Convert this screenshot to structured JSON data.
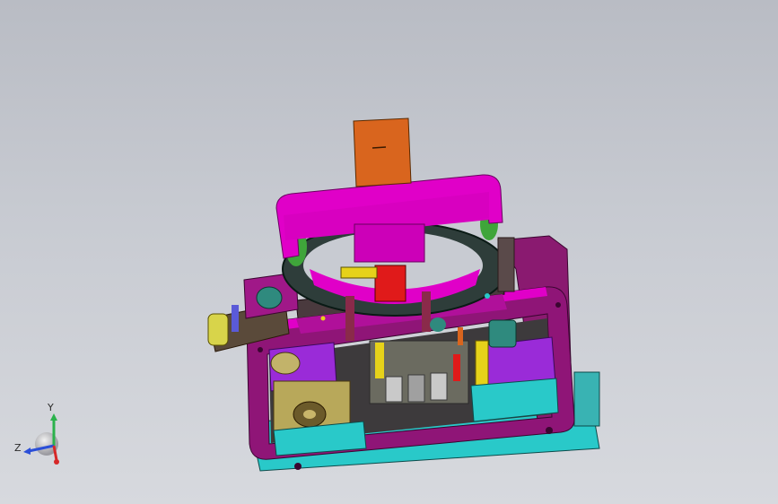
{
  "viewport": {
    "background_top": "#b9bcc4",
    "background_bottom": "#d7d9de"
  },
  "triad": {
    "y_label": "Y",
    "z_label": "Z",
    "y_color": "#2bb24c",
    "z_color": "#2b4fd8",
    "x_color": "#d62828"
  },
  "model_colors": {
    "magenta": "#e000c8",
    "dark_magenta": "#7a0a5a",
    "purple": "#9a2bd8",
    "cyan": "#29c9c9",
    "orange": "#d9651e",
    "red": "#e01a1a",
    "yellow": "#e6d21a",
    "olive": "#b8a85a",
    "teal": "#2f8a7e",
    "dark_gray": "#4a4a4a"
  }
}
